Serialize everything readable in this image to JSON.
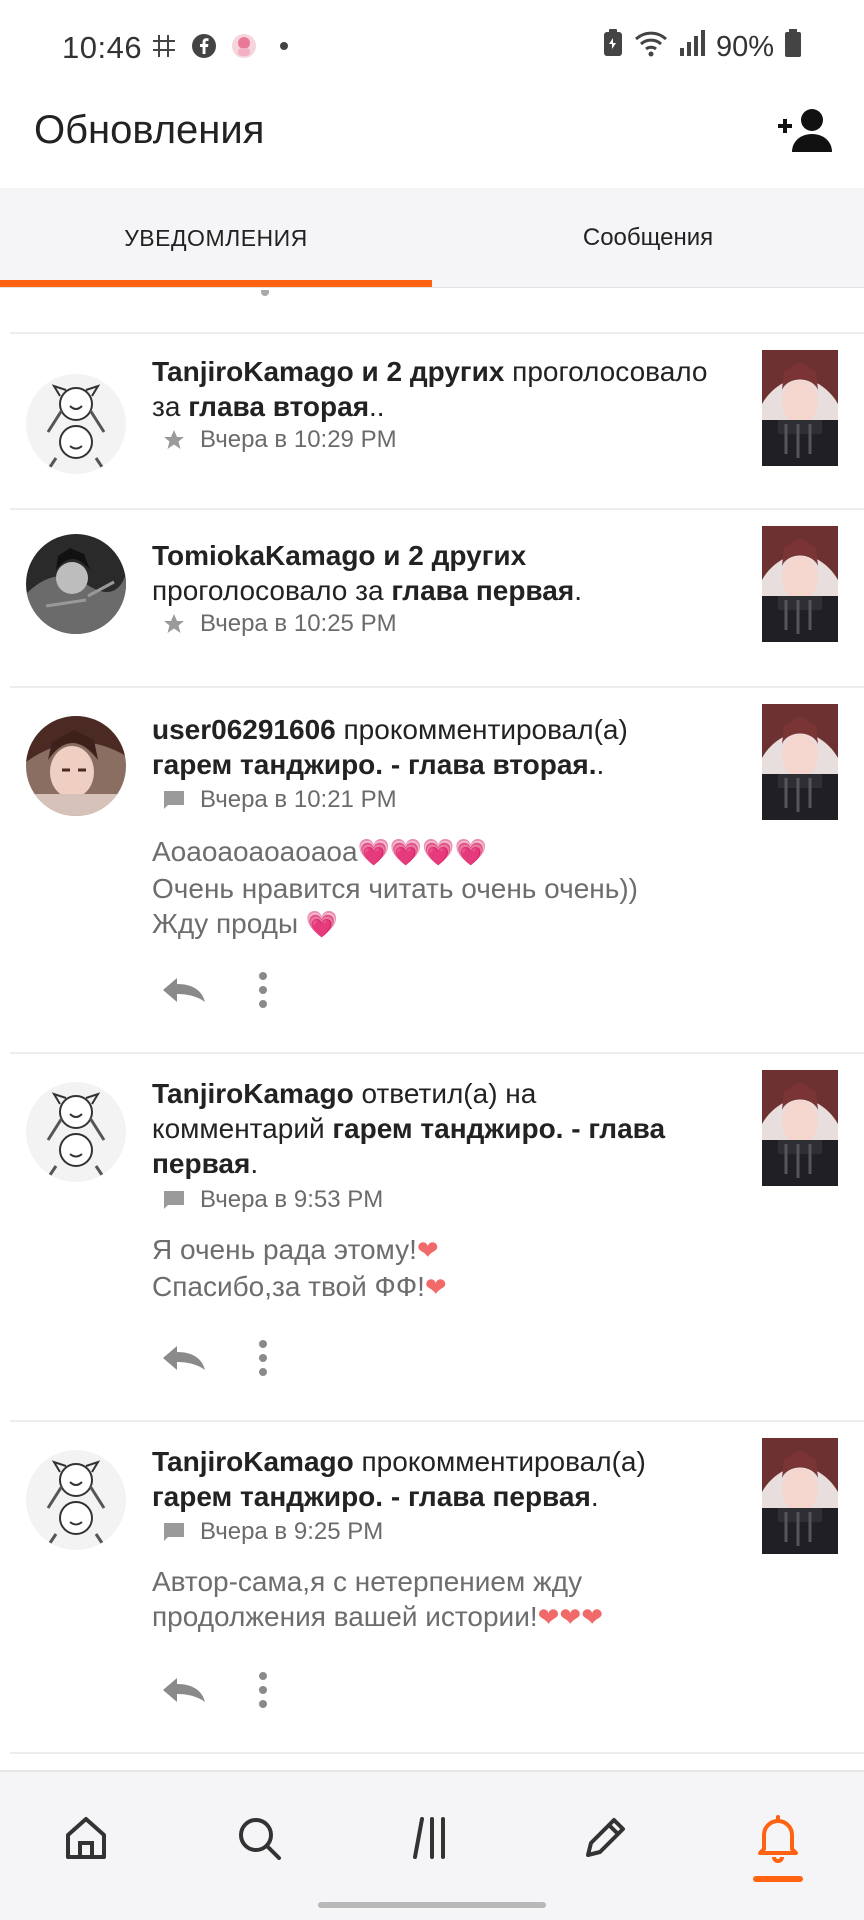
{
  "status_bar": {
    "time": "10:46",
    "battery": "90%",
    "icons": [
      "hashtag-icon",
      "facebook-icon",
      "app-avatar-icon",
      "dot-icon",
      "battery-saver-icon",
      "wifi-icon",
      "signal-icon",
      "battery-icon"
    ]
  },
  "header": {
    "title": "Обновления",
    "add_user_icon": "add-user-icon"
  },
  "tabs": {
    "notifications": "УВЕДОМЛЕНИЯ",
    "messages": "Сообщения",
    "active": "notifications",
    "accent": "#ff6210"
  },
  "notifications": [
    {
      "avatar": "manga-characters-avatar",
      "line1_bold": "TanjiroKamago и 2 других",
      "line1_rest": " проголосовало",
      "line2_lead": "за ",
      "line2_bold": "глава вторая",
      "line2_rest": "..",
      "meta_icon": "star-icon",
      "time": "Вчера в 10:29 PM"
    },
    {
      "avatar": "dark-manga-avatar",
      "line1_bold": "TomiokaKamago и 2 других",
      "line2_lead": "проголосовало за ",
      "line2_bold": "глава первая",
      "line2_rest": ".",
      "meta_icon": "star-icon",
      "time": "Вчера в 10:25 PM"
    },
    {
      "avatar": "anime-boy-avatar",
      "line1_bold": "user06291606",
      "line1_rest": " прокомментировал(а)",
      "line2_bold": "гарем танджиро. - глава вторая.",
      "line2_rest": ".",
      "meta_icon": "comment-icon",
      "time": "Вчера в 10:21 PM",
      "comment": [
        "Аоаоаоаоаоаоа",
        "Очень нравится читать очень очень))",
        "Жду проды "
      ],
      "comment_emoji": [
        "💗💗💗💗",
        "",
        "💗"
      ]
    },
    {
      "avatar": "manga-characters-avatar",
      "line1_bold": "TanjiroKamago",
      "line1_rest": " ответил(а) на",
      "line2_lead": "комментарий ",
      "line2_bold": "гарем танджиро. - глава",
      "line3_bold": "первая",
      "line3_rest": ".",
      "meta_icon": "comment-icon",
      "time": "Вчера в 9:53 PM",
      "comment": [
        "Я очень рада этому!",
        "Спасибо,за твой ФФ!"
      ],
      "comment_emoji": [
        "❤",
        "❤"
      ]
    },
    {
      "avatar": "manga-characters-avatar",
      "line1_bold": "TanjiroKamago",
      "line1_rest": " прокомментировал(а)",
      "line2_bold": "гарем танджиро. - глава первая",
      "line2_rest": ".",
      "meta_icon": "comment-icon",
      "time": "Вчера в 9:25 PM",
      "comment": [
        "Автор-сама,я с нетерпением жду",
        "продолжения вашей истории!"
      ],
      "comment_emoji": [
        "",
        "❤❤❤"
      ]
    }
  ],
  "bottom_nav": {
    "items": [
      "home-icon",
      "search-icon",
      "library-icon",
      "write-icon",
      "notifications-icon"
    ],
    "active": "notifications-icon",
    "accent": "#ff6210"
  }
}
